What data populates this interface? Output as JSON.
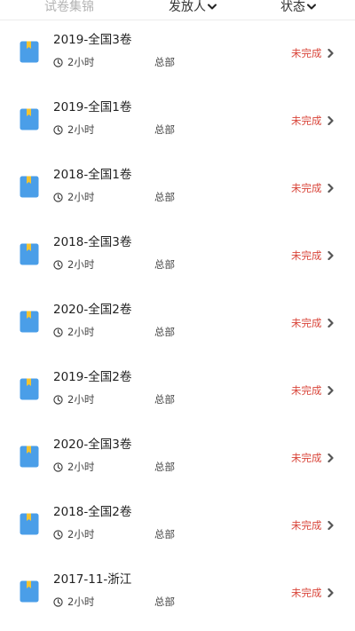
{
  "header": {
    "col_title": "试卷集锦",
    "col_sender": "发放人",
    "col_status": "状态"
  },
  "colors": {
    "book_blue": "#4a9ee8",
    "bookmark_yellow": "#f4c430",
    "status_red": "#d9453a"
  },
  "papers": [
    {
      "title": "2019-全国3卷",
      "duration": "2小时",
      "sender": "总部",
      "status": "未完成"
    },
    {
      "title": "2019-全国1卷",
      "duration": "2小时",
      "sender": "总部",
      "status": "未完成"
    },
    {
      "title": "2018-全国1卷",
      "duration": "2小时",
      "sender": "总部",
      "status": "未完成"
    },
    {
      "title": "2018-全国3卷",
      "duration": "2小时",
      "sender": "总部",
      "status": "未完成"
    },
    {
      "title": "2020-全国2卷",
      "duration": "2小时",
      "sender": "总部",
      "status": "未完成"
    },
    {
      "title": "2019-全国2卷",
      "duration": "2小时",
      "sender": "总部",
      "status": "未完成"
    },
    {
      "title": "2020-全国3卷",
      "duration": "2小时",
      "sender": "总部",
      "status": "未完成"
    },
    {
      "title": "2018-全国2卷",
      "duration": "2小时",
      "sender": "总部",
      "status": "未完成"
    },
    {
      "title": "2017-11-浙江",
      "duration": "2小时",
      "sender": "总部",
      "status": "未完成"
    }
  ]
}
